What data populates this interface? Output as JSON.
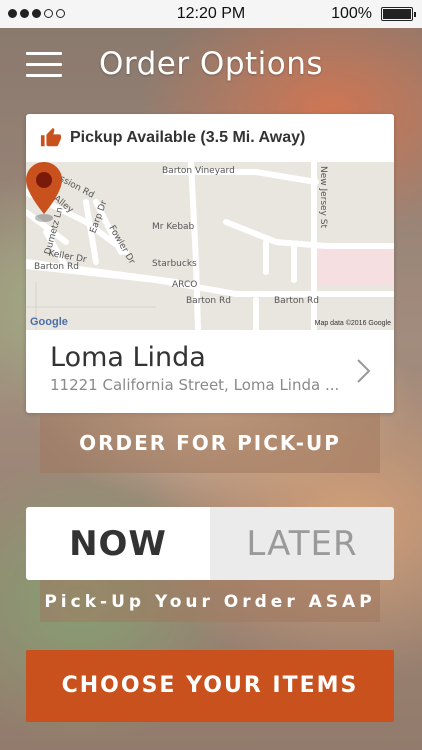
{
  "status_bar": {
    "time": "12:20 PM",
    "battery": "100%",
    "battery_level": 1.0,
    "signal_bars_filled": 3,
    "signal_bars_total": 5
  },
  "header": {
    "title": "Order Options",
    "menu_icon": "hamburger-menu-icon"
  },
  "location_card": {
    "pickup_text": "Pickup Available (3.5 Mi. Away)",
    "pickup_icon": "thumbs-up-icon",
    "map": {
      "labels": [
        "Mission Rd",
        "Alley Alley",
        "Earp Dr",
        "Fowler Dr",
        "Dumetz Ln",
        "Keller Dr",
        "Barton Rd",
        "Barton Vineyard",
        "Mr Kebab",
        "Starbucks",
        "ARCO",
        "Barton Rd",
        "Barton Rd",
        "New Jersey St"
      ],
      "logo_text": "Google",
      "credit": "Map data ©2016 Google"
    },
    "name": "Loma Linda",
    "address": "11221 California Street, Loma Linda ...",
    "chevron_icon": "chevron-right-icon"
  },
  "order_type_label": "ORDER FOR PICK-UP",
  "time_toggle": {
    "now_label": "NOW",
    "later_label": "LATER",
    "selected": "NOW"
  },
  "asap_text": "Pick-Up Your Order ASAP",
  "cta_label": "CHOOSE YOUR ITEMS",
  "colors": {
    "accent": "#c8511e",
    "pin": "#c8511e",
    "pickup_icon": "#c8511e"
  }
}
